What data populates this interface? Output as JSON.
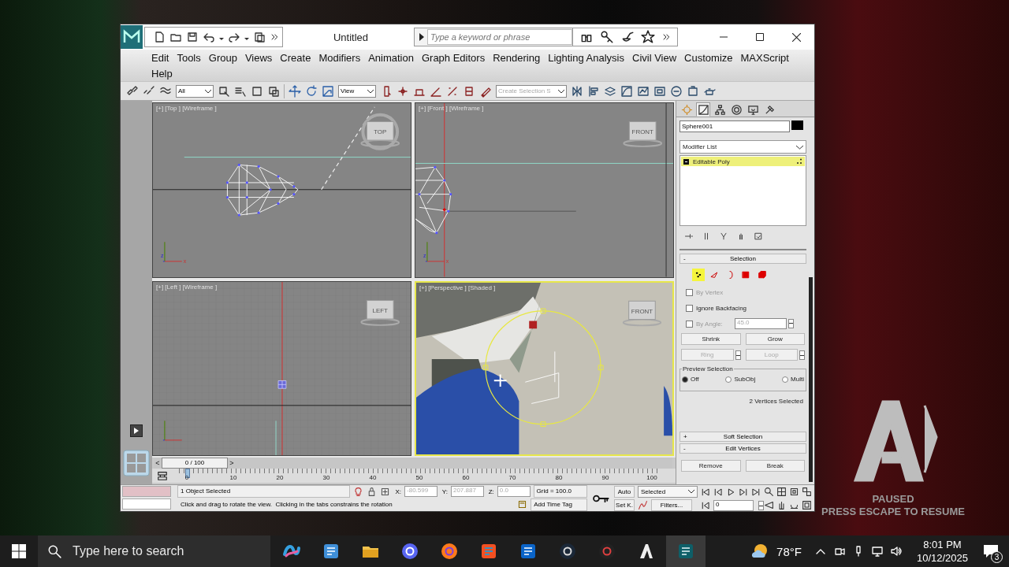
{
  "overlay": {
    "title": "PAUSED",
    "hint": "PRESS ESCAPE TO RESUME"
  },
  "window": {
    "title": "Untitled",
    "search": {
      "placeholder": "Type a keyword or phrase"
    }
  },
  "menu_rows": [
    [
      "Edit",
      "Tools",
      "Group",
      "Views",
      "Create",
      "Modifiers",
      "Animation",
      "Graph Editors",
      "Rendering",
      "Lighting Analysis",
      "Civil View",
      "Customize",
      "MAXScript"
    ],
    [
      "Help"
    ]
  ],
  "toolbar": {
    "selection_filter": "All",
    "reference_coordinate": "View",
    "named_selection": {
      "placeholder": "Create Selection S"
    }
  },
  "viewports": [
    {
      "kind": "top",
      "label": "[+] [Top ] [Wireframe ]",
      "cube_label": "TOP",
      "axes": [
        "z",
        "x"
      ],
      "selected": false
    },
    {
      "kind": "front",
      "label": "[+] [Front ] [Wireframe ]",
      "cube_label": "FRONT",
      "axes": [
        "z",
        "x"
      ],
      "selected": false
    },
    {
      "kind": "left",
      "label": "[+] [Left ] [Wireframe ]",
      "cube_label": "LEFT",
      "selected": false
    },
    {
      "kind": "perspective",
      "label": "[+] [Perspective ] [Shaded ]",
      "cube_label": "FRONT",
      "selected": true
    }
  ],
  "command_panel": {
    "tabs": [
      {
        "kind": "create",
        "selected": false
      },
      {
        "kind": "modify",
        "selected": true
      },
      {
        "kind": "hierarchy",
        "selected": false
      },
      {
        "kind": "motion",
        "selected": false
      },
      {
        "kind": "display",
        "selected": false
      },
      {
        "kind": "utilities",
        "selected": false
      }
    ],
    "object_name": "Sphere001",
    "modifier_list": "Modifier List",
    "stack": [
      {
        "label": "Editable Poly",
        "selected": true
      }
    ],
    "selection": {
      "sign": "-",
      "title": "Selection",
      "levels": [
        {
          "kind": "vertex",
          "selected": true
        },
        {
          "kind": "edge",
          "selected": false
        },
        {
          "kind": "border",
          "selected": false
        },
        {
          "kind": "polygon",
          "selected": false
        },
        {
          "kind": "element",
          "selected": false
        }
      ],
      "checkboxes": [
        {
          "label": "By Vertex",
          "checked": false,
          "disabled": true
        },
        {
          "label": "Ignore Backfacing",
          "checked": false,
          "disabled": false
        },
        {
          "label": "By Angle:",
          "checked": false,
          "disabled": true,
          "value": "45.0"
        }
      ],
      "buttons": [
        {
          "label": "Shrink",
          "disabled": false,
          "spinner": false
        },
        {
          "label": "Grow",
          "disabled": false,
          "spinner": false
        },
        {
          "label": "Ring",
          "disabled": true,
          "spinner": true
        },
        {
          "label": "Loop",
          "disabled": true,
          "spinner": true
        }
      ],
      "preview": {
        "title": "Preview Selection",
        "options": [
          {
            "label": "Off",
            "selected": true
          },
          {
            "label": "SubObj",
            "selected": false
          },
          {
            "label": "Multi",
            "selected": false
          }
        ]
      },
      "status": "2 Vertices Selected"
    },
    "rollouts": [
      {
        "sign": "+",
        "title": "Soft Selection"
      },
      {
        "sign": "-",
        "title": "Edit Vertices",
        "buttons": [
          "Remove",
          "Break"
        ]
      }
    ]
  },
  "timeline": {
    "prev": "<",
    "position": "0 / 100",
    "level": 0,
    "next": ">",
    "ticks": [
      "0",
      "10",
      "20",
      "30",
      "40",
      "50",
      "60",
      "70",
      "80",
      "90",
      "100"
    ]
  },
  "status": {
    "selection": "1 Object Selected",
    "prompt": "Click and drag to rotate the view.  Clicking in the tabs constrains the rotation",
    "coords": [
      {
        "axis": "X:",
        "value": "-80.599"
      },
      {
        "axis": "Y:",
        "value": "207.887"
      },
      {
        "axis": "Z:",
        "value": "0.0"
      }
    ],
    "grid": "Grid = 100.0",
    "time_tag": "Add Time Tag",
    "auto_key": "Auto",
    "set_key": "Set K.",
    "key_filter": "Selected",
    "filters": "Filters...",
    "frame": "0"
  },
  "taskbar": {
    "search_placeholder": "Type here to search",
    "apps": [
      {
        "kind": "ribbon",
        "selected": false
      },
      {
        "kind": "notepad",
        "selected": false
      },
      {
        "kind": "folder",
        "selected": false
      },
      {
        "kind": "chat",
        "selected": false
      },
      {
        "kind": "globe",
        "selected": false
      },
      {
        "kind": "bag",
        "selected": false
      },
      {
        "kind": "mail",
        "selected": false
      },
      {
        "kind": "disc",
        "selected": false
      },
      {
        "kind": "ring",
        "selected": false
      },
      {
        "kind": "letter",
        "selected": false
      },
      {
        "kind": "max",
        "selected": true
      }
    ],
    "weather": "78°F",
    "time": "8:01 PM",
    "date": "10/12/2025",
    "notifications": "3"
  }
}
